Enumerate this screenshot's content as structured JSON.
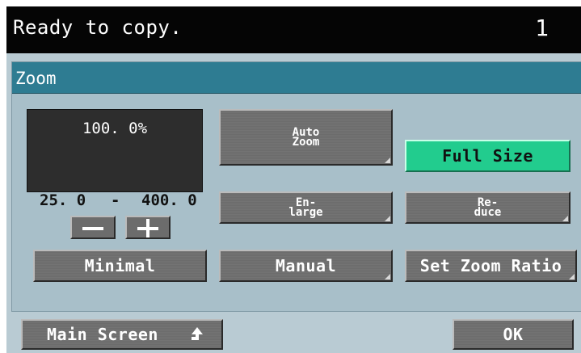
{
  "status_bar": {
    "message": "Ready to copy.",
    "copy_count": "1"
  },
  "zoom_panel": {
    "title": "Zoom",
    "ratio_display": "100. 0%",
    "range_min": "25. 0",
    "range_separator": "-",
    "range_max": "400. 0",
    "decrease_icon": "minus-icon",
    "increase_icon": "plus-icon",
    "buttons": {
      "auto_zoom": "Auto\nZoom",
      "full_size": "Full Size",
      "enlarge": "En-\nlarge",
      "reduce": "Re-\nduce",
      "minimal": "Minimal",
      "manual": "Manual",
      "set_zoom_ratio": "Set Zoom Ratio"
    },
    "active_button": "full_size"
  },
  "footer": {
    "main_screen": "Main Screen",
    "main_screen_icon": "up-arrow-icon",
    "ok": "OK"
  },
  "colors": {
    "status_bar": "#050505",
    "panel_header": "#2e7c92",
    "panel_background": "#a8bfc9",
    "button": "#6c6c6c",
    "active_button": "#22cc8e",
    "ratio_display": "#2d2d2d"
  }
}
